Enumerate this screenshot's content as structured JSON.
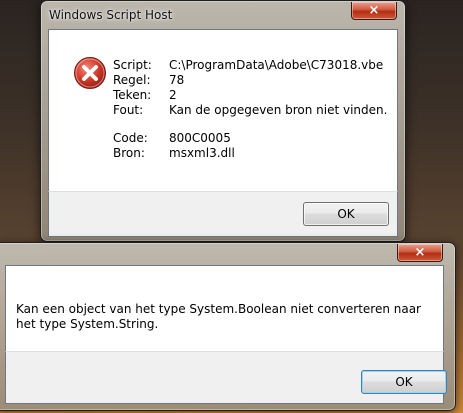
{
  "dialog1": {
    "title": "Windows Script Host",
    "close_glyph": "×",
    "icon": "error-icon",
    "rows": [
      {
        "label": "Script:",
        "value": "C:\\ProgramData\\Adobe\\C73018.vbe"
      },
      {
        "label": "Regel:",
        "value": "78"
      },
      {
        "label": "Teken:",
        "value": "2"
      },
      {
        "label": "Fout:",
        "value": "Kan de opgegeven bron niet vinden."
      }
    ],
    "rows2": [
      {
        "label": "Code:",
        "value": "800C0005"
      },
      {
        "label": "Bron:",
        "value": "msxml3.dll"
      }
    ],
    "ok_label": "OK"
  },
  "dialog2": {
    "close_glyph": "×",
    "message": "Kan een object van het type System.Boolean niet converteren naar het type System.String.",
    "ok_label": "OK"
  },
  "colors": {
    "close_button": "#c7472a",
    "error_icon": "#c42b1c"
  }
}
